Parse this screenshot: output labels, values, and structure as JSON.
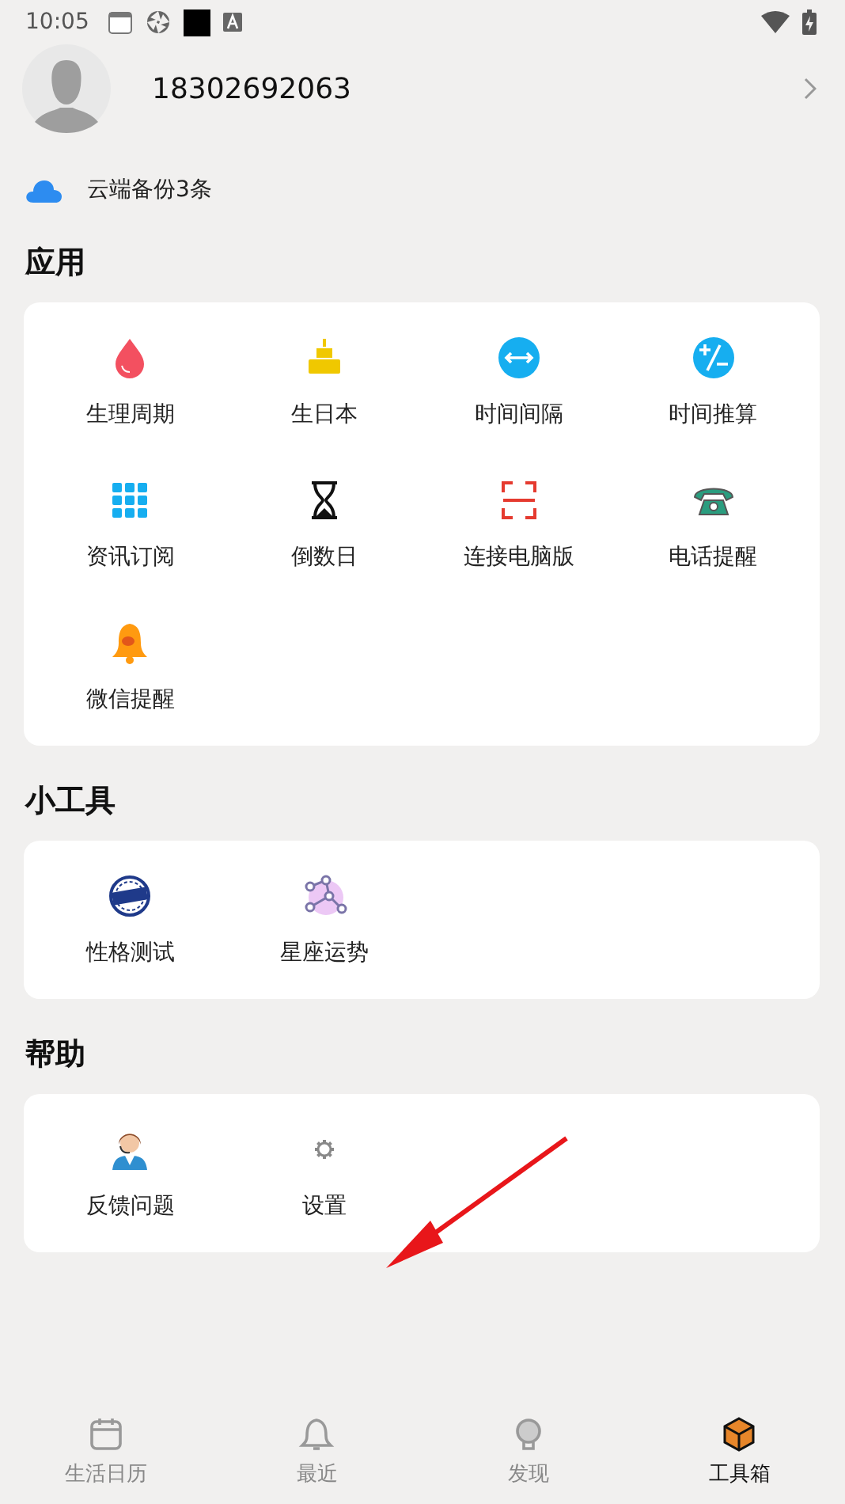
{
  "status_bar": {
    "time": "10:05"
  },
  "profile": {
    "phone": "18302692063"
  },
  "cloud_backup": {
    "text": "云端备份3条"
  },
  "sections": [
    {
      "title": "应用",
      "items": [
        {
          "label": "生理周期"
        },
        {
          "label": "生日本"
        },
        {
          "label": "时间间隔"
        },
        {
          "label": "时间推算"
        },
        {
          "label": "资讯订阅"
        },
        {
          "label": "倒数日"
        },
        {
          "label": "连接电脑版"
        },
        {
          "label": "电话提醒"
        },
        {
          "label": "微信提醒"
        }
      ]
    },
    {
      "title": "小工具",
      "items": [
        {
          "label": "性格测试"
        },
        {
          "label": "星座运势"
        }
      ]
    },
    {
      "title": "帮助",
      "items": [
        {
          "label": "反馈问题"
        },
        {
          "label": "设置"
        }
      ]
    }
  ],
  "tab_bar": [
    {
      "label": "生活日历",
      "selected": false
    },
    {
      "label": "最近",
      "selected": false
    },
    {
      "label": "发现",
      "selected": false
    },
    {
      "label": "工具箱",
      "selected": true
    }
  ]
}
